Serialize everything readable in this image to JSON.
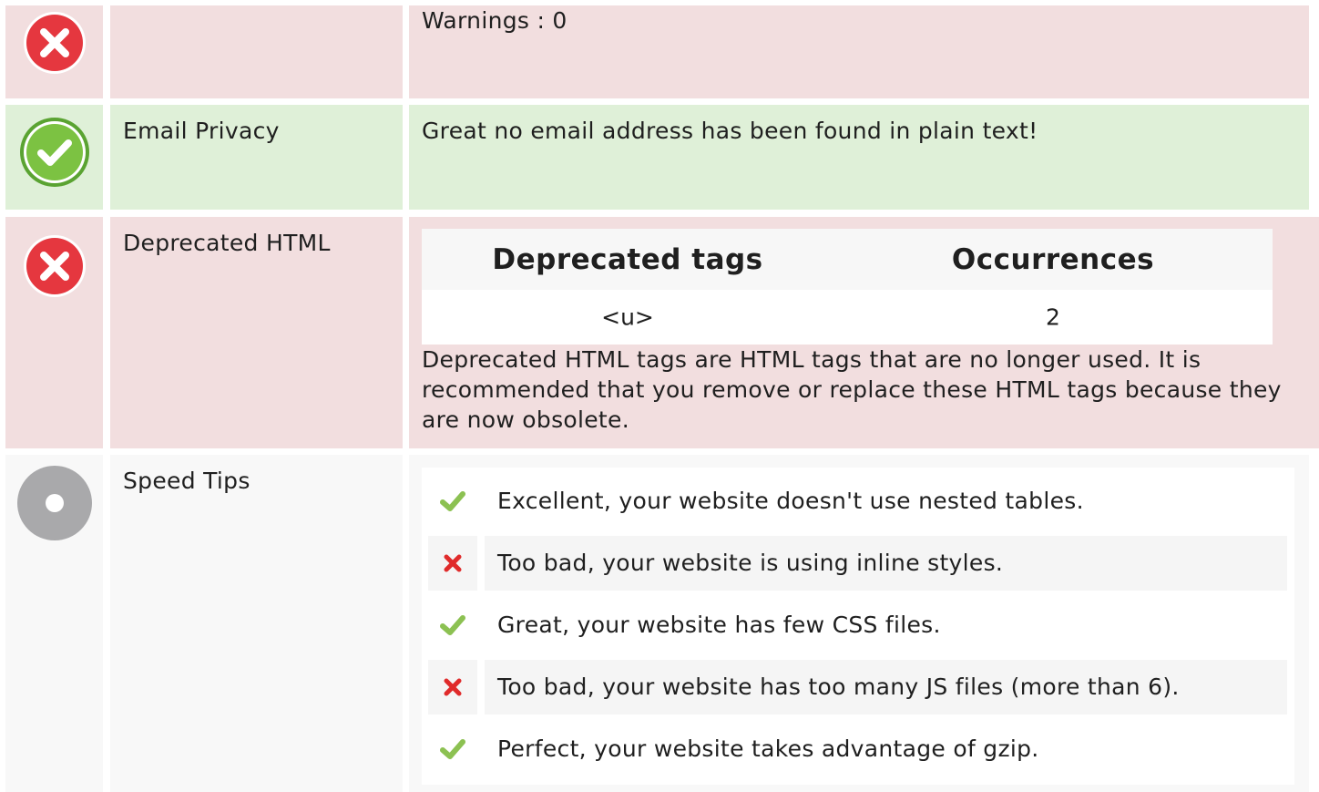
{
  "colors": {
    "error_bg": "#f2dedf",
    "success_bg": "#dff0d8",
    "neutral_bg": "#f8f8f8",
    "error_icon": "#e5373f",
    "success_icon": "#7cc242",
    "neutral_icon": "#a9a9ab",
    "check_mark": "#8cc152",
    "cross_mark": "#e02b2b"
  },
  "rows": [
    {
      "status": "error",
      "icon": "error-x-icon",
      "label": "",
      "content": "Warnings : 0"
    },
    {
      "status": "success",
      "icon": "success-check-icon",
      "label": "Email Privacy",
      "content": "Great no email address has been found in plain text!"
    },
    {
      "status": "error",
      "icon": "error-x-icon",
      "label": "Deprecated HTML",
      "table": {
        "headers": [
          "Deprecated tags",
          "Occurrences"
        ],
        "rows": [
          [
            "<u>",
            "2"
          ]
        ]
      },
      "content": "Deprecated HTML tags are HTML tags that are no longer used. It is recommended that you remove or replace these HTML tags because they are now obsolete."
    },
    {
      "status": "neutral",
      "icon": "neutral-dot-icon",
      "label": "Speed Tips",
      "tips": [
        {
          "icon": "check-icon",
          "text": "Excellent, your website doesn't use nested tables."
        },
        {
          "icon": "cross-icon",
          "text": "Too bad, your website is using inline styles."
        },
        {
          "icon": "check-icon",
          "text": "Great, your website has few CSS files."
        },
        {
          "icon": "cross-icon",
          "text": "Too bad, your website has too many JS files (more than 6)."
        },
        {
          "icon": "check-icon",
          "text": "Perfect, your website takes advantage of gzip."
        }
      ]
    }
  ]
}
